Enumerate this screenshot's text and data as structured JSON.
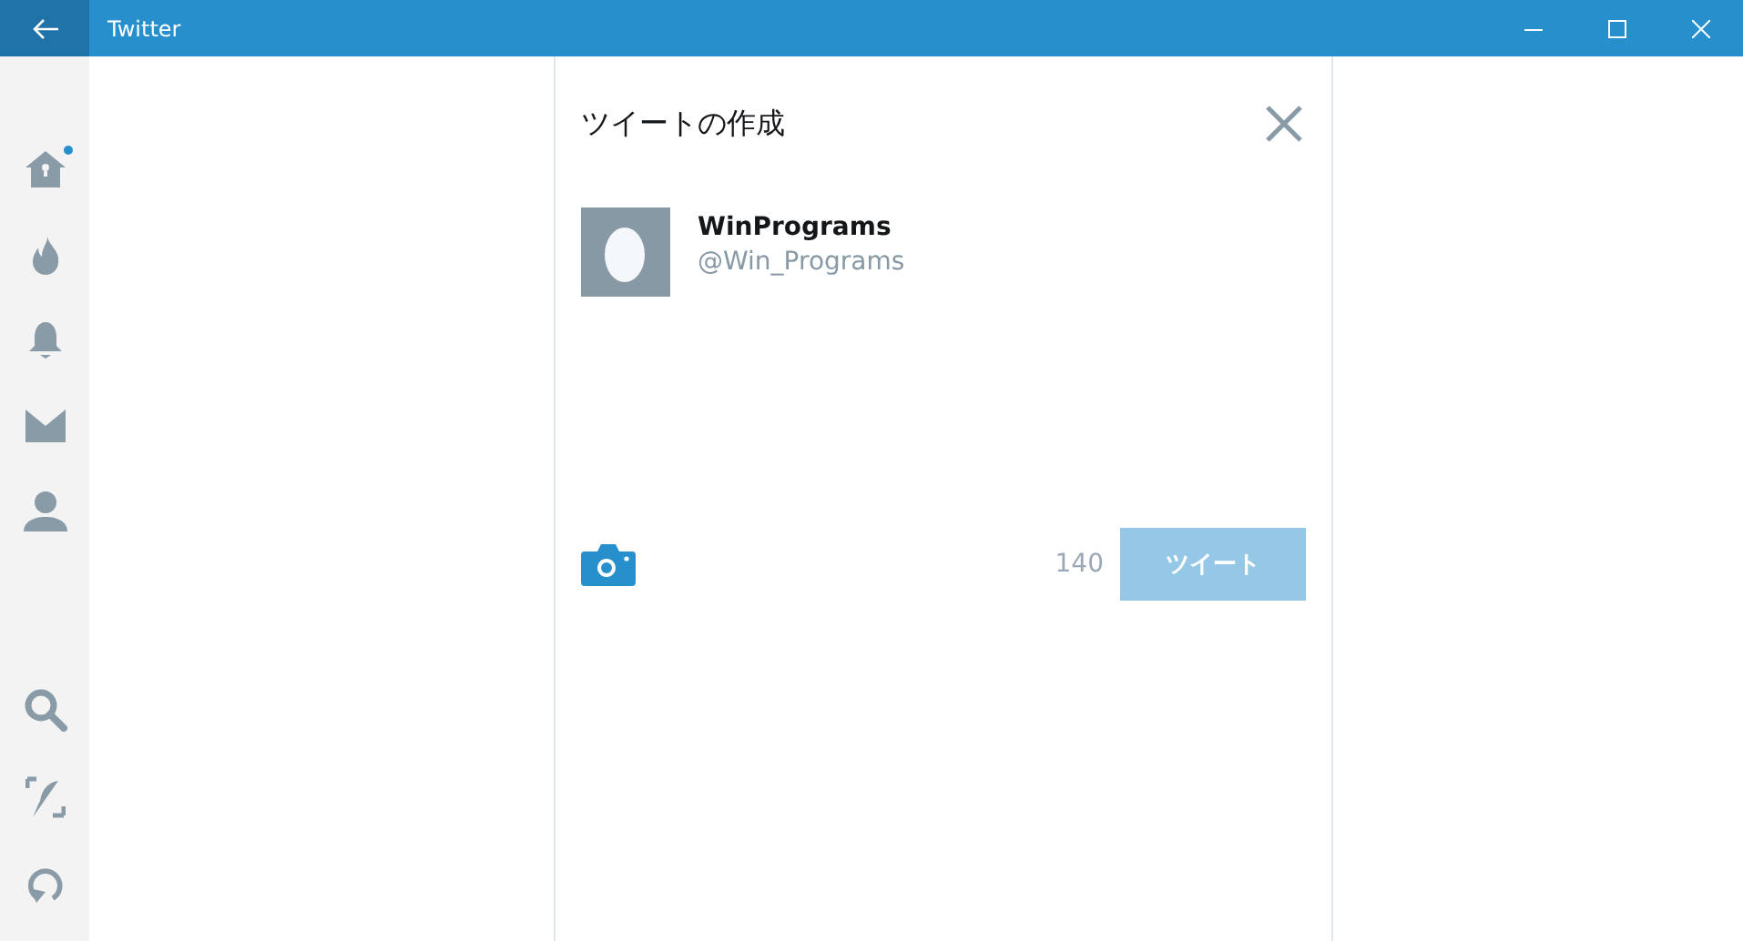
{
  "window": {
    "title": "Twitter"
  },
  "sidebar": {
    "top_items": [
      {
        "kind": "home",
        "unread": true
      },
      {
        "kind": "trends",
        "unread": false
      },
      {
        "kind": "notifications",
        "unread": false
      },
      {
        "kind": "messages",
        "unread": false
      },
      {
        "kind": "profile",
        "unread": false
      }
    ],
    "bottom_items": [
      {
        "kind": "search"
      },
      {
        "kind": "compose"
      },
      {
        "kind": "refresh"
      }
    ]
  },
  "compose": {
    "title": "ツイートの作成",
    "user": {
      "name": "WinPrograms",
      "handle": "@Win_Programs"
    },
    "counter": "140",
    "tweet_button": {
      "label": "ツイート",
      "disabled": true
    }
  }
}
